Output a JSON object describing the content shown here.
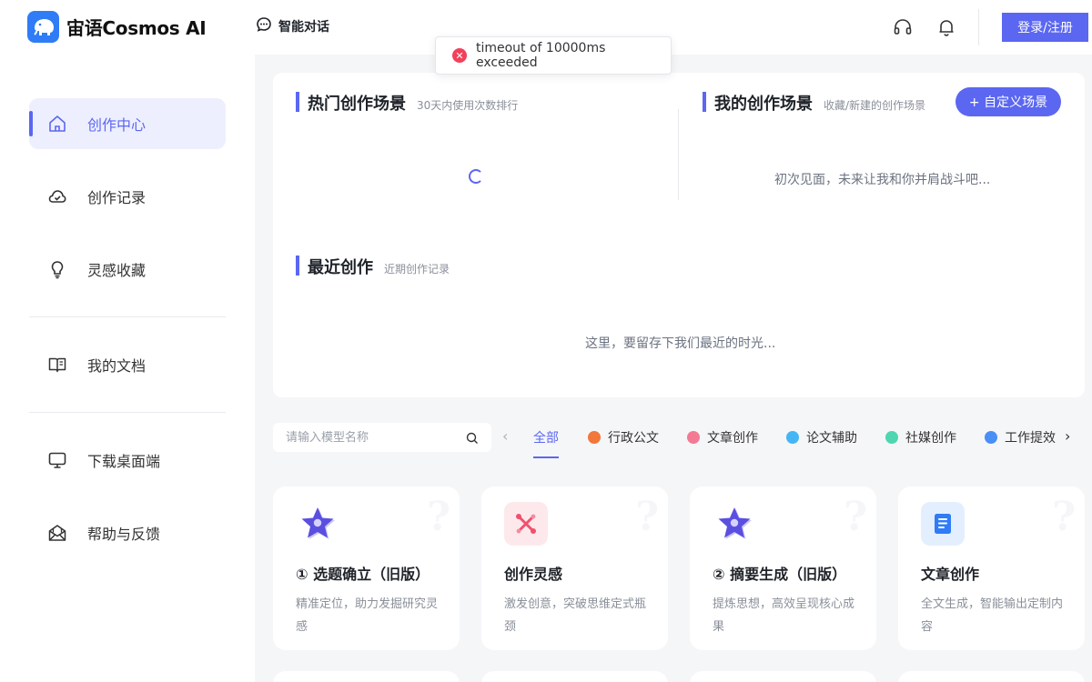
{
  "header": {
    "brand": "宙语Cosmos AI",
    "nav_chat": "智能对话",
    "login_label": "登录/注册"
  },
  "toast": {
    "message": "timeout of 10000ms exceeded",
    "icon": "error-icon"
  },
  "sidebar": {
    "items": [
      {
        "label": "创作中心",
        "icon": "home-icon",
        "active": true
      },
      {
        "label": "创作记录",
        "icon": "cloud-icon"
      },
      {
        "label": "灵感收藏",
        "icon": "lightbulb-icon"
      },
      {
        "label": "我的文档",
        "icon": "book-icon"
      },
      {
        "label": "下载桌面端",
        "icon": "monitor-icon"
      },
      {
        "label": "帮助与反馈",
        "icon": "mail-icon"
      }
    ]
  },
  "hot_scenes": {
    "title": "热门创作场景",
    "subtitle": "30天内使用次数排行"
  },
  "my_scenes": {
    "title": "我的创作场景",
    "subtitle": "收藏/新建的创作场景",
    "button_label": "+ 自定义场景",
    "empty_text": "初次见面，未来让我和你并肩战斗吧..."
  },
  "recent": {
    "title": "最近创作",
    "subtitle": "近期创作记录",
    "empty_text": "这里，要留存下我们最近的时光..."
  },
  "search": {
    "placeholder": "请输入模型名称"
  },
  "categories": [
    {
      "label": "全部",
      "active": true
    },
    {
      "label": "行政公文",
      "color": "#f2773a"
    },
    {
      "label": "文章创作",
      "color": "#f27a95"
    },
    {
      "label": "论文辅助",
      "color": "#45b6f5"
    },
    {
      "label": "社媒创作",
      "color": "#4fd6b0"
    },
    {
      "label": "工作提效",
      "color": "#4a8ff5"
    }
  ],
  "cards": [
    {
      "title": "① 选题确立（旧版）",
      "desc": "精准定位，助力发掘研究灵感",
      "icon": "star-icon"
    },
    {
      "title": "创作灵感",
      "desc": "激发创意，突破思维定式瓶颈",
      "icon": "sparkle-icon"
    },
    {
      "title": "② 摘要生成（旧版）",
      "desc": "提炼思想，高效呈现核心成果",
      "icon": "star-icon"
    },
    {
      "title": "文章创作",
      "desc": "全文生成，智能输出定制内容",
      "icon": "document-icon"
    }
  ]
}
